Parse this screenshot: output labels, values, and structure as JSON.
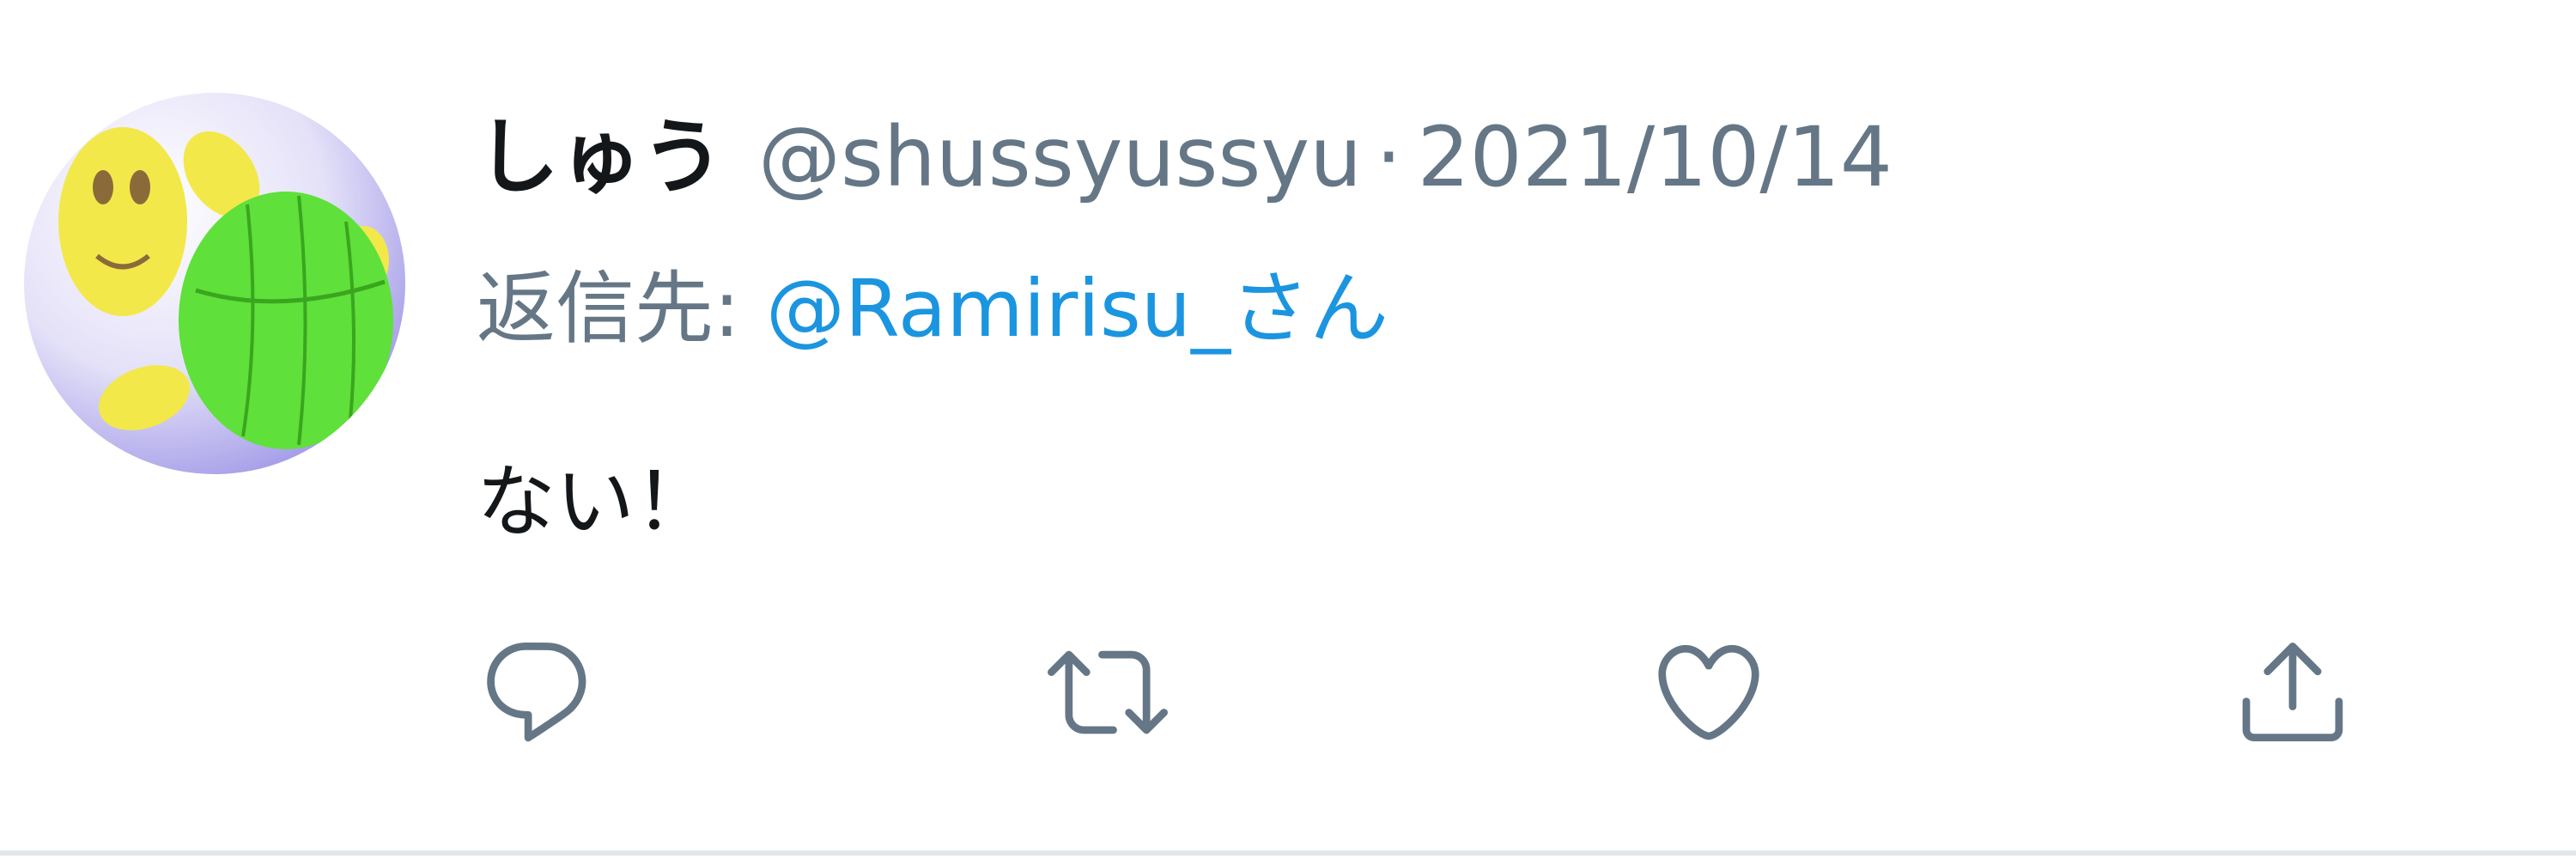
{
  "tweet": {
    "display_name": "しゅう",
    "handle": "@shussyussyu",
    "separator": "·",
    "date": "2021/10/14",
    "reply_prefix": "返信先:",
    "reply_target": "@Ramirisu_さん",
    "text": "ない！"
  },
  "avatar": {
    "description_icon": "turtle-avatar-icon",
    "colors": {
      "shell": "#5fe03a",
      "body": "#f2e84a",
      "background": "#c9c3f2"
    }
  },
  "actions": [
    {
      "name": "reply",
      "icon": "reply-icon"
    },
    {
      "name": "retweet",
      "icon": "retweet-icon"
    },
    {
      "name": "like",
      "icon": "heart-icon"
    },
    {
      "name": "share",
      "icon": "share-icon"
    }
  ],
  "colors": {
    "primary_text": "#14171a",
    "secondary_text": "#657786",
    "link": "#1b95e0",
    "icon": "#657786"
  }
}
